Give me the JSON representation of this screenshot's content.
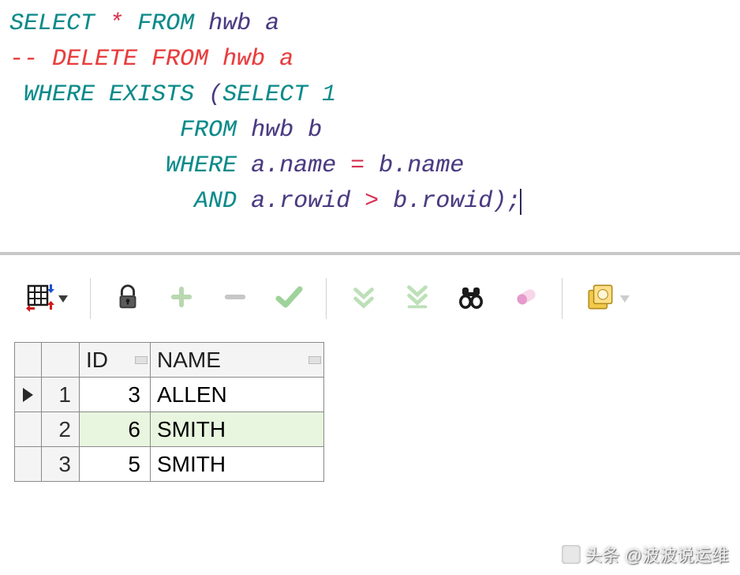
{
  "sql": {
    "line1": {
      "kw1": "SELECT",
      "star": "*",
      "kw2": "FROM",
      "id1": "hwb",
      "id2": "a"
    },
    "line2": {
      "comment_lead": "-- ",
      "comment_text": "DELETE FROM hwb a"
    },
    "line3": {
      "kw1": "WHERE",
      "kw2": "EXISTS",
      "paren": "(",
      "kw3": "SELECT",
      "num": "1"
    },
    "line4": {
      "kw1": "FROM",
      "id1": "hwb",
      "id2": "b"
    },
    "line5": {
      "kw1": "WHERE",
      "id1": "a",
      "dot1": ".",
      "id2": "name",
      "eq": "=",
      "id3": "b",
      "dot2": ".",
      "id4": "name"
    },
    "line6": {
      "kw1": "AND",
      "id1": "a",
      "dot1": ".",
      "id2": "rowid",
      "gt": ">",
      "id3": "b",
      "dot2": ".",
      "id4": "rowid",
      "close": ")",
      "semi": ";"
    }
  },
  "toolbar": {
    "grid_icon": "grid-view",
    "lock_icon": "lock",
    "plus_icon": "add-row",
    "minus_icon": "delete-row",
    "check_icon": "commit",
    "down1_icon": "fetch-next",
    "down2_icon": "fetch-all",
    "binoc_icon": "find",
    "pill_icon": "filter",
    "export_icon": "export"
  },
  "results": {
    "columns": [
      "ID",
      "NAME"
    ],
    "rows": [
      {
        "n": "1",
        "id": "3",
        "name": "ALLEN",
        "current": false
      },
      {
        "n": "2",
        "id": "6",
        "name": "SMITH",
        "current": true
      },
      {
        "n": "3",
        "id": "5",
        "name": "SMITH",
        "current": false
      }
    ]
  },
  "watermark": {
    "text": "头条 @波波说运维"
  }
}
